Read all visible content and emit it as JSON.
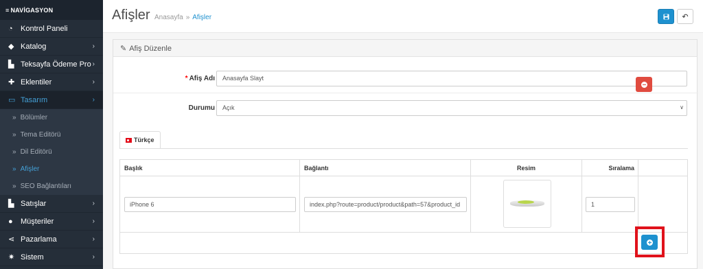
{
  "sidebar": {
    "header": "NAVİGASYON",
    "items": [
      {
        "label": "Kontrol Paneli",
        "icon": "dashboard-icon"
      },
      {
        "label": "Katalog",
        "icon": "tag-icon"
      },
      {
        "label": "Teksayfa Ödeme Pro",
        "icon": "cart-icon"
      },
      {
        "label": "Eklentiler",
        "icon": "puzzle-icon"
      },
      {
        "label": "Tasarım",
        "icon": "monitor-icon"
      }
    ],
    "subitems": [
      {
        "label": "Bölümler"
      },
      {
        "label": "Tema Editörü"
      },
      {
        "label": "Dil Editörü"
      },
      {
        "label": "Afişler"
      },
      {
        "label": "SEO Bağlantıları"
      }
    ],
    "items2": [
      {
        "label": "Satışlar",
        "icon": "cart-icon"
      },
      {
        "label": "Müşteriler",
        "icon": "user-icon"
      },
      {
        "label": "Pazarlama",
        "icon": "share-icon"
      },
      {
        "label": "Sistem",
        "icon": "gear-icon"
      }
    ]
  },
  "header": {
    "title": "Afişler",
    "breadcrumb_home": "Anasayfa",
    "breadcrumb_sep": "»",
    "breadcrumb_current": "Afişler"
  },
  "panel": {
    "title": "Afiş Düzenle"
  },
  "form": {
    "name_label": "Afiş Adı",
    "name_value": "Anasayfa Slayt",
    "status_label": "Durumu",
    "status_value": "Açık"
  },
  "tabs": [
    {
      "label": "Türkçe"
    }
  ],
  "table": {
    "headers": [
      "Başlık",
      "Bağlantı",
      "Resim",
      "Sıralama"
    ],
    "rows": [
      {
        "title": "iPhone 6",
        "link": "index.php?route=product/product&path=57&product_id",
        "sort": "1"
      }
    ]
  },
  "colors": {
    "primary": "#1e91cf",
    "danger": "#e04b3f",
    "sidebar_bg": "#252e39",
    "highlight": "#e0121b"
  }
}
